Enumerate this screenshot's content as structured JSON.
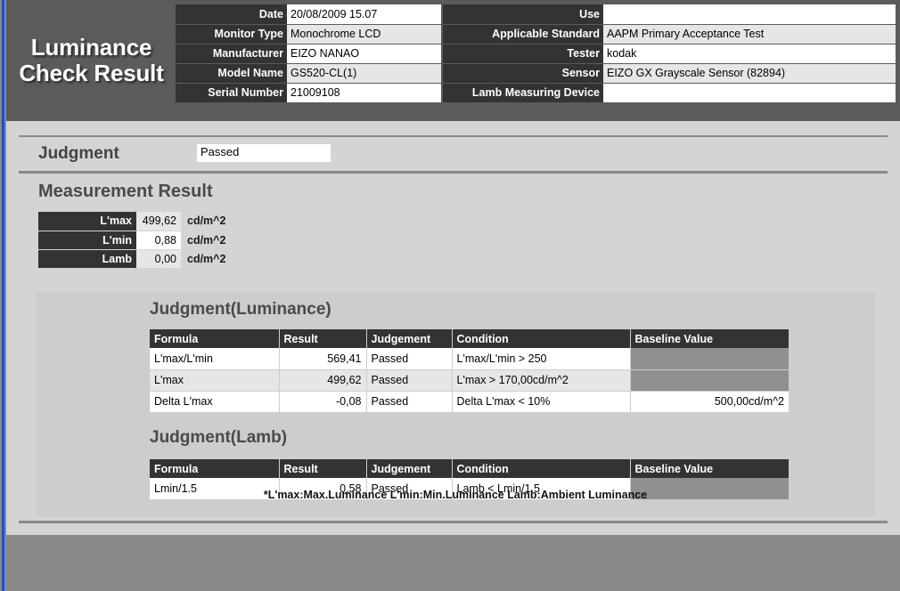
{
  "title": {
    "line1": "Luminance",
    "line2": "Check Result"
  },
  "header": {
    "left_rows": [
      {
        "label": "Date",
        "value": "20/08/2009 15.07"
      },
      {
        "label": "Monitor Type",
        "value": "Monochrome LCD"
      },
      {
        "label": "Manufacturer",
        "value": "EIZO NANAO"
      },
      {
        "label": "Model Name",
        "value": "GS520-CL(1)"
      },
      {
        "label": "Serial Number",
        "value": "21009108"
      }
    ],
    "right_rows": [
      {
        "label": "Use",
        "value": ""
      },
      {
        "label": "Applicable Standard",
        "value": "AAPM Primary Acceptance Test"
      },
      {
        "label": "Tester",
        "value": "kodak"
      },
      {
        "label": "Sensor",
        "value": "EIZO GX Grayscale Sensor (82894)"
      },
      {
        "label": "Lamb Measuring Device",
        "value": ""
      }
    ]
  },
  "judgment": {
    "label": "Judgment",
    "value": "Passed"
  },
  "measurement": {
    "title": "Measurement Result",
    "rows": [
      {
        "key": "L'max",
        "value": "499,62",
        "unit": "cd/m^2"
      },
      {
        "key": "L'min",
        "value": "0,88",
        "unit": "cd/m^2"
      },
      {
        "key": "Lamb",
        "value": "0,00",
        "unit": "cd/m^2"
      }
    ]
  },
  "luminance": {
    "title": "Judgment(Luminance)",
    "columns": [
      "Formula",
      "Result",
      "Judgement",
      "Condition",
      "Baseline Value"
    ],
    "rows": [
      {
        "formula": "L'max/L'min",
        "result": "569,41",
        "judgement": "Passed",
        "condition": "L'max/L'min > 250",
        "baseline": ""
      },
      {
        "formula": "L'max",
        "result": "499,62",
        "judgement": "Passed",
        "condition": "L'max > 170,00cd/m^2",
        "baseline": ""
      },
      {
        "formula": "Delta L'max",
        "result": "-0,08",
        "judgement": "Passed",
        "condition": "Delta L'max < 10%",
        "baseline": "500,00cd/m^2"
      }
    ]
  },
  "lamb": {
    "title": "Judgment(Lamb)",
    "columns": [
      "Formula",
      "Result",
      "Judgement",
      "Condition",
      "Baseline Value"
    ],
    "rows": [
      {
        "formula": "Lmin/1.5",
        "result": "0,58",
        "judgement": "Passed",
        "condition": "Lamb < Lmin/1.5",
        "baseline": ""
      }
    ]
  },
  "footnote": "*L'max:Max.Luminance L'min:Min.Luminance Lamb:Ambient Luminance",
  "colors": {
    "header_bg": "#5b5b5b",
    "label_bg": "#333333",
    "panel_bg": "#d4d4d4",
    "subpanel_bg": "#cdcdcd",
    "empty_cell": "#909090",
    "rail_blue": "#1a4fdc",
    "page_edge": "#8a8a8a"
  }
}
